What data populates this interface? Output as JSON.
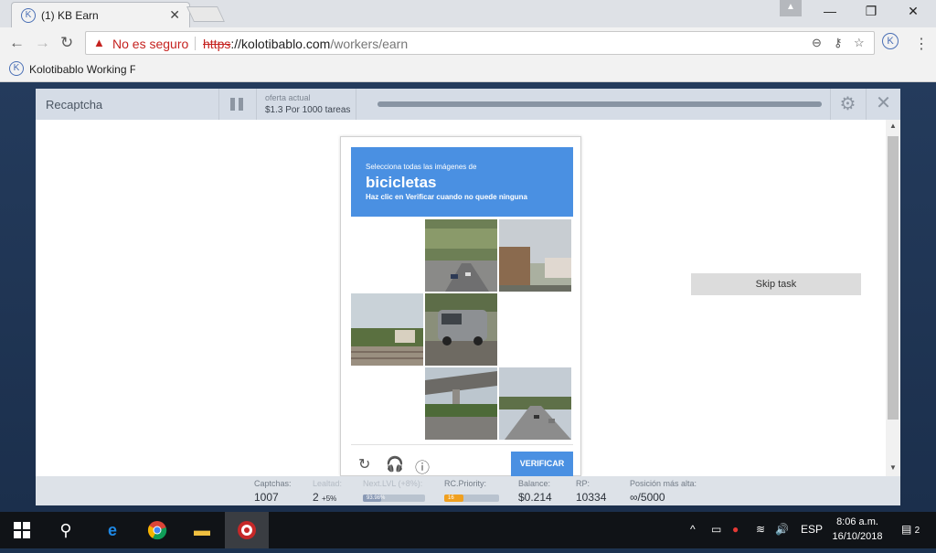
{
  "browser": {
    "tab_title": "(1) KB Earn",
    "tab_favicon": "K",
    "tab_close": "✕",
    "security_label": "No es seguro",
    "url_scheme": "https",
    "url_host": "://kolotibablo.com",
    "url_path": "/workers/earn",
    "bookmark_label": "Kolotibablo Working F",
    "bookmark_icon": "K",
    "extension_icon": "K",
    "user_icon": "▲",
    "window_minimize": "—",
    "window_maximize": "❐",
    "window_close": "✕"
  },
  "app": {
    "title": "Recaptcha",
    "offer_label": "oferta actual",
    "offer_value": "$1.3 Por 1000 tareas",
    "progress_fraction": 1.0,
    "skip_label": "Skip task"
  },
  "captcha": {
    "instruction_small": "Selecciona todas las imágenes de",
    "keyword": "bicicletas",
    "instruction_hint": "Haz clic en Verificar cuando no quede ninguna",
    "verify_label": "VERIFICAR",
    "tiles": [
      {
        "scene": "blank"
      },
      {
        "scene": "street-trees"
      },
      {
        "scene": "building"
      },
      {
        "scene": "rail-houses"
      },
      {
        "scene": "van"
      },
      {
        "scene": "blank"
      },
      {
        "scene": "blank"
      },
      {
        "scene": "overpass"
      },
      {
        "scene": "highway"
      }
    ]
  },
  "stats": {
    "captchas_label": "Captchas:",
    "captchas_value": "1007",
    "leaitad_label": "Lealtad:",
    "leaitad_value": "2",
    "leaitad_suffix": "+5%",
    "nextlvl_label": "Next.LVL (+8%):",
    "nextlvl_bar_text": "93.98%",
    "nextlvl_fraction": 0.3,
    "priority_label": "RC.Priority:",
    "priority_value": "16",
    "priority_fraction": 0.35,
    "balance_label": "Balance:",
    "balance_value": "$0.214",
    "rp_label": "RP:",
    "rp_value": "10334",
    "position_label": "Posición más alta:",
    "position_value": "∞/5000"
  },
  "colors": {
    "captcha_blue": "#4a90e2",
    "warning_red": "#c5221f",
    "priority_orange": "#f0a020"
  },
  "taskbar": {
    "language": "ESP",
    "time": "8:06 a.m.",
    "date": "16/10/2018",
    "notification_count": "2"
  }
}
